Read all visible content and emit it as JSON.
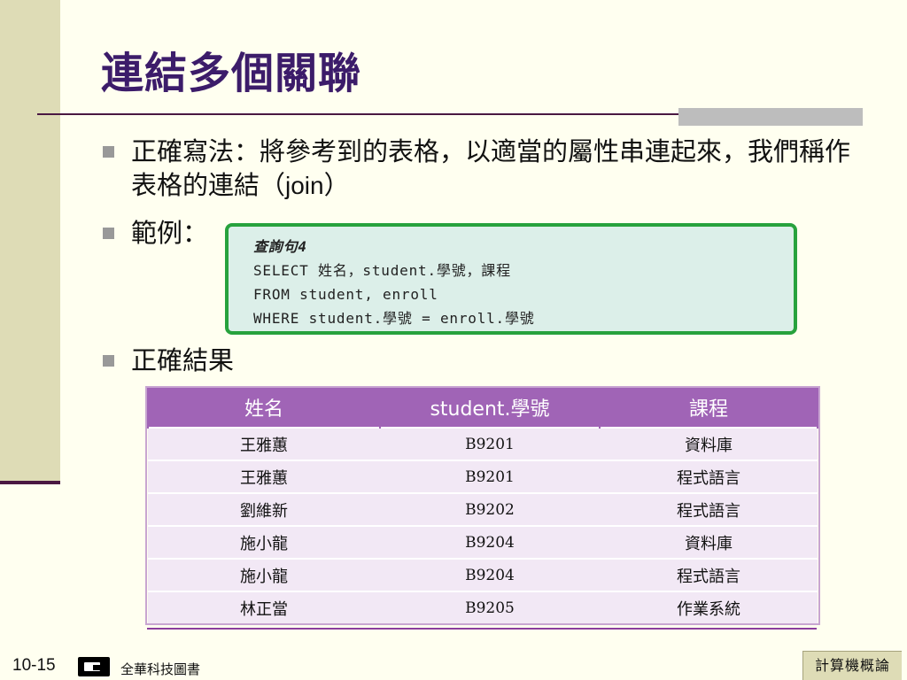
{
  "slide": {
    "title": "連結多個關聯",
    "bullets": [
      {
        "text_before_join": "正確寫法：將參考到的表格，以適當的屬性串連起來，我們稱作表格的連結（",
        "join": "join",
        "text_after_join": "）"
      },
      {
        "text": "範例："
      },
      {
        "text": "正確結果"
      }
    ],
    "code": {
      "heading": "查詢句4",
      "lines": [
        "SELECT 姓名，student.學號，課程",
        "FROM student, enroll",
        "WHERE student.學號 = enroll.學號"
      ]
    },
    "table": {
      "headers": [
        "姓名",
        "student.學號",
        "課程"
      ],
      "rows": [
        [
          "王雅蕙",
          "B9201",
          "資料庫"
        ],
        [
          "王雅蕙",
          "B9201",
          "程式語言"
        ],
        [
          "劉維新",
          "B9202",
          "程式語言"
        ],
        [
          "施小龍",
          "B9204",
          "資料庫"
        ],
        [
          "施小龍",
          "B9204",
          "程式語言"
        ],
        [
          "林正當",
          "B9205",
          "作業系統"
        ]
      ]
    },
    "footer": {
      "page_number": "10-15",
      "publisher": "全華科技圖書",
      "course": "計算機概論"
    },
    "colors": {
      "title": "#3c1c6a",
      "rule": "#4a1842",
      "code_border": "#27a23d",
      "table_header": "#a064b6",
      "table_row": "#f2e8f5"
    },
    "icons": {
      "bullet": "square-bullet-icon",
      "publisher_logo": "publisher-logo-icon"
    }
  }
}
